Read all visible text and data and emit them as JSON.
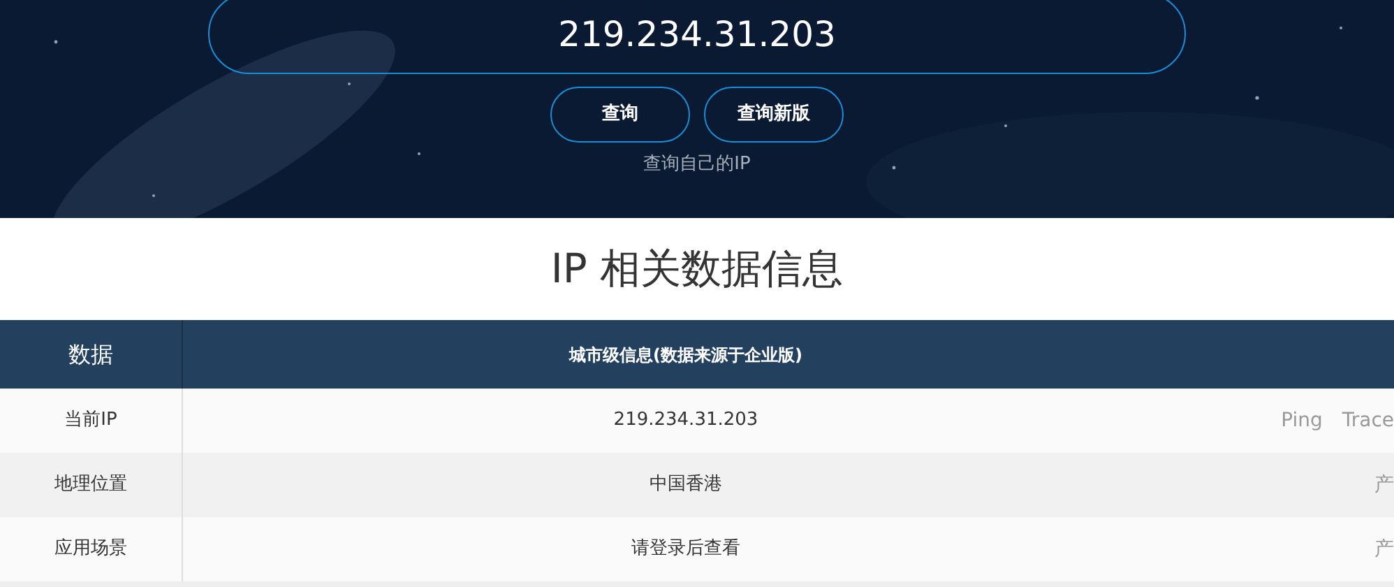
{
  "hero": {
    "search": {
      "value": "219.234.31.203"
    },
    "buttons": [
      "查询",
      "查询新版"
    ],
    "self_link": "查询自己的IP"
  },
  "section_title": "IP 相关数据信息",
  "table": {
    "columns": [
      "数据",
      "城市级信息(数据来源于企业版)"
    ],
    "rows": [
      {
        "label": "当前IP",
        "value": "219.234.31.203",
        "links": [
          "Ping",
          "Trace"
        ]
      },
      {
        "label": "地理位置",
        "value": "中国香港",
        "links": [
          "产"
        ]
      },
      {
        "label": "应用场景",
        "value": "请登录后查看",
        "links": [
          "产"
        ]
      }
    ]
  }
}
